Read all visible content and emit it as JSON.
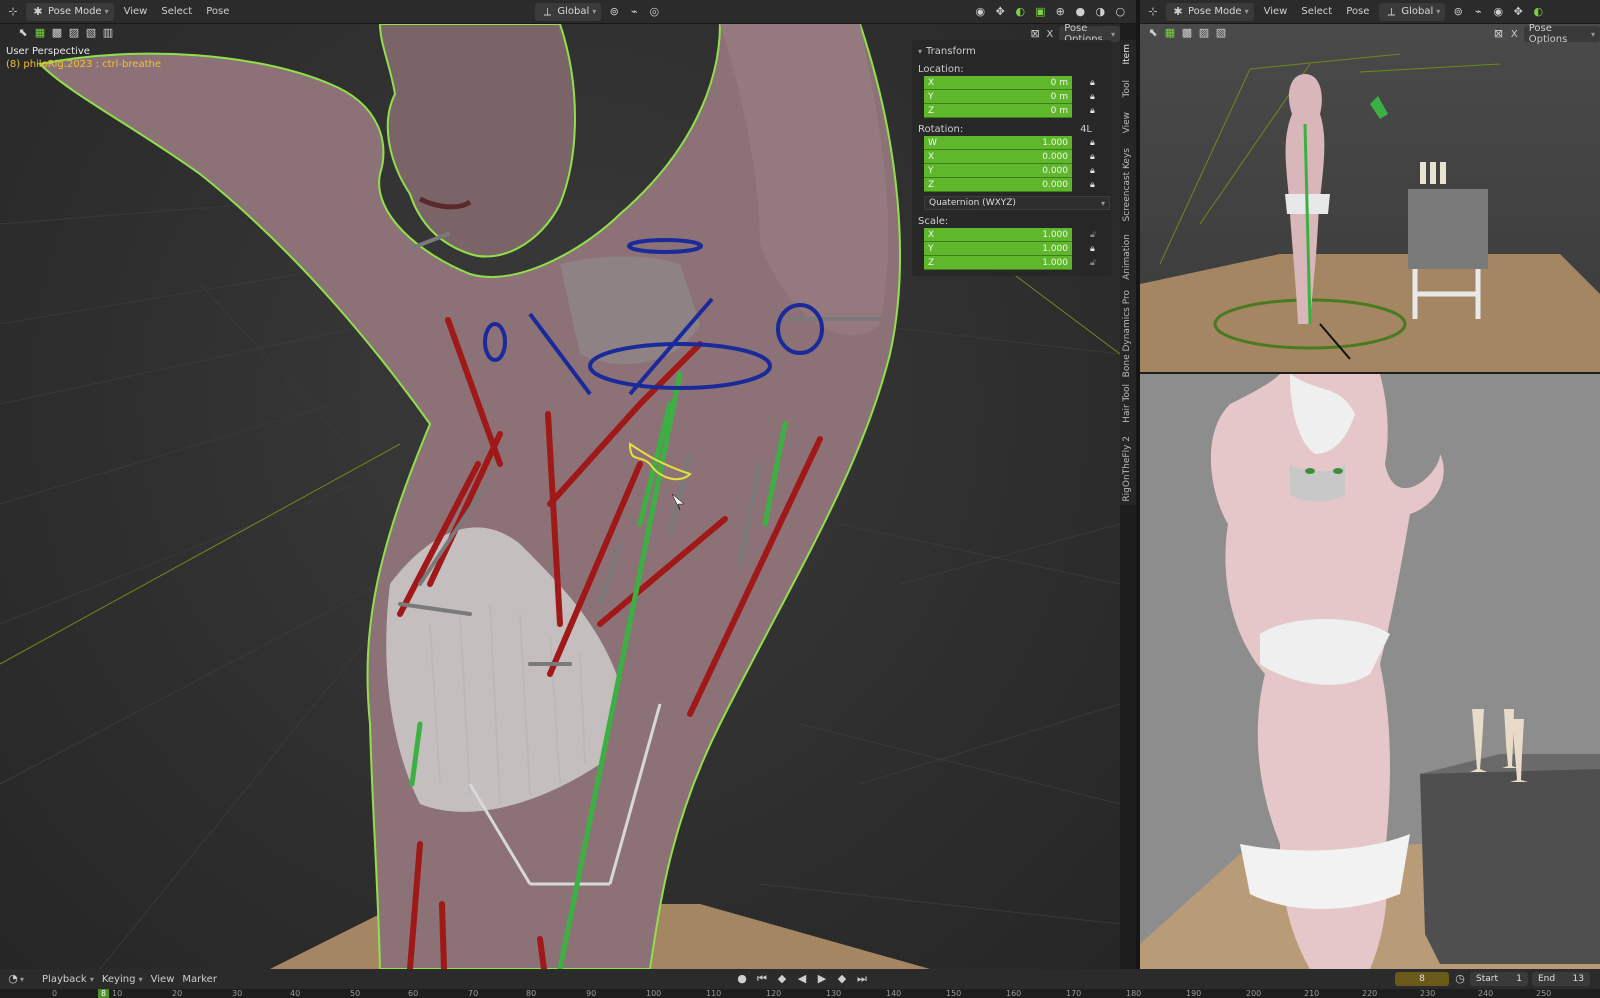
{
  "main_header": {
    "mode": "Pose Mode",
    "menus": [
      "View",
      "Select",
      "Pose"
    ],
    "orientation": "Global",
    "pose_options": "Pose Options"
  },
  "viewport": {
    "perspective": "User Perspective",
    "object_info": "(8) philoRig.2023 : ctrl-breathe"
  },
  "npanel": {
    "title": "Transform",
    "location_label": "Location:",
    "location": [
      {
        "axis": "X",
        "value": "0 m"
      },
      {
        "axis": "Y",
        "value": "0 m"
      },
      {
        "axis": "Z",
        "value": "0 m"
      }
    ],
    "rotation_label": "Rotation:",
    "rotation_extra": "4L",
    "rotation": [
      {
        "axis": "W",
        "value": "1.000"
      },
      {
        "axis": "X",
        "value": "0.000"
      },
      {
        "axis": "Y",
        "value": "0.000"
      },
      {
        "axis": "Z",
        "value": "0.000"
      }
    ],
    "rotation_mode": "Quaternion (WXYZ)",
    "scale_label": "Scale:",
    "scale": [
      {
        "axis": "X",
        "value": "1.000"
      },
      {
        "axis": "Y",
        "value": "1.000"
      },
      {
        "axis": "Z",
        "value": "1.000"
      }
    ]
  },
  "side_tabs": [
    "Item",
    "Tool",
    "View",
    "Screencast Keys",
    "Animation",
    "Bone Dynamics Pro",
    "Hair Tool",
    "RigOnTheFly 2"
  ],
  "right_header": {
    "mode": "Pose Mode",
    "menus": [
      "View",
      "Select",
      "Pose"
    ],
    "orientation": "Global",
    "pose_options": "Pose Options"
  },
  "timeline": {
    "menus": [
      "Playback",
      "Keying",
      "View",
      "Marker"
    ],
    "current_frame": "8",
    "start_label": "Start",
    "start_value": "1",
    "end_label": "End",
    "end_value": "13",
    "ruler": [
      "0",
      "8",
      "10",
      "20",
      "30",
      "40",
      "50",
      "60",
      "70",
      "80",
      "90",
      "100",
      "110",
      "120",
      "130",
      "140",
      "150",
      "160",
      "170",
      "180",
      "190",
      "200",
      "210",
      "220",
      "230",
      "240",
      "250"
    ]
  },
  "colors": {
    "accent_green": "#5fb82b",
    "selection_outline": "#8fe04a",
    "bone_red": "#a01818",
    "bone_blue": "#1a2a9a",
    "text_yellow": "#f0c232"
  }
}
